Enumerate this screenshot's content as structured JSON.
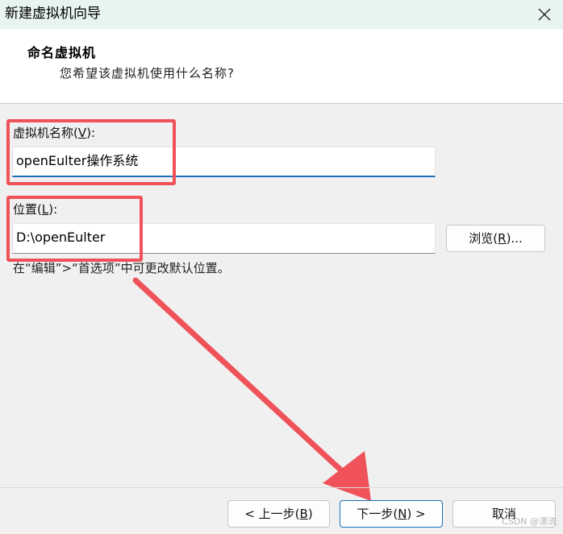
{
  "window": {
    "title": "新建虚拟机向导",
    "close_glyph": "✕"
  },
  "header": {
    "title": "命名虚拟机",
    "subtitle": "您希望该虚拟机使用什么名称?"
  },
  "form": {
    "name_label_prefix": "虚拟机名称(",
    "name_label_key": "V",
    "name_label_suffix": "):",
    "name_value": "openEulter操作系统",
    "location_label_prefix": "位置(",
    "location_label_key": "L",
    "location_label_suffix": "):",
    "location_value": "D:\\openEulter",
    "browse_prefix": "浏览(",
    "browse_key": "R",
    "browse_suffix": ")...",
    "hint": "在“编辑”>“首选项”中可更改默认位置。"
  },
  "footer": {
    "back_prefix": "< 上一步(",
    "back_key": "B",
    "back_suffix": ")",
    "next_prefix": "下一步(",
    "next_key": "N",
    "next_suffix": ") >",
    "cancel_label": "取消"
  },
  "annotation": {
    "highlight_color": "#f0525a"
  },
  "watermark": "CSDN @漂流"
}
